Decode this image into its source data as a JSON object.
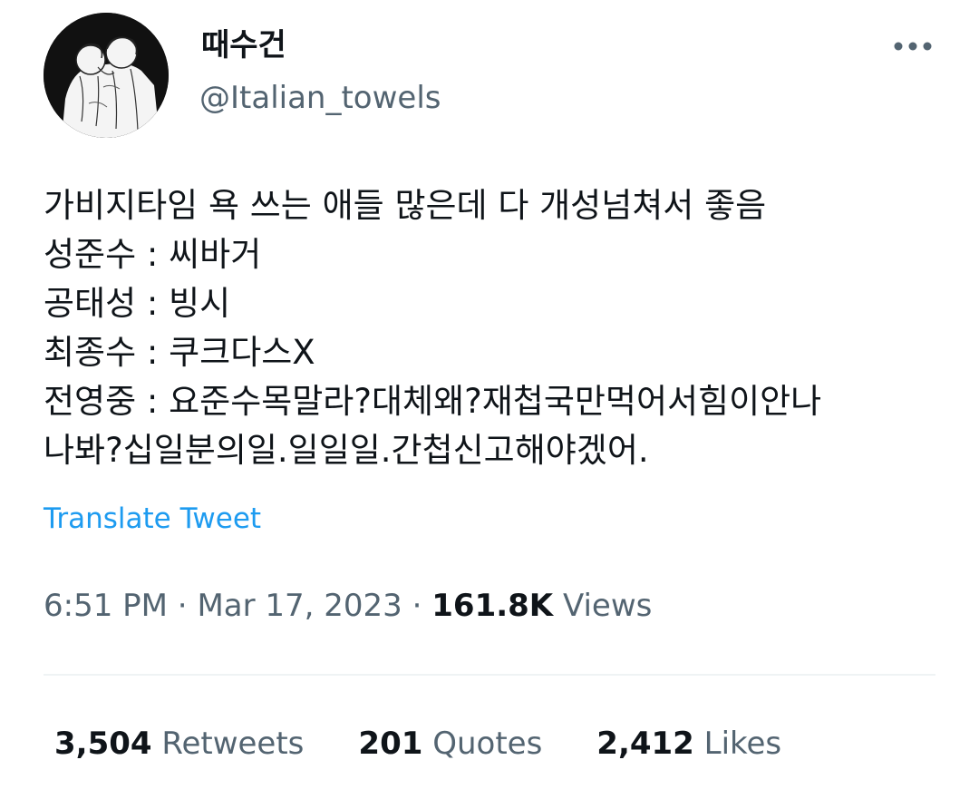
{
  "user": {
    "display_name": "때수건",
    "handle": "@Italian_towels",
    "avatar_icon": "profile-avatar-drawing"
  },
  "tweet": {
    "lines": [
      "가비지타임 욕 쓰는 애들 많은데 다 개성넘쳐서 좋음",
      "성준수 : 씨바거",
      "공태성 : 빙시",
      "최종수 : 쿠크다스X",
      "전영중 : 요준수목말라?대체왜?재첩국만먹어서힘이안나",
      "나봐?십일분의일.일일일.간첩신고해야겠어."
    ],
    "translate_label": "Translate Tweet"
  },
  "meta": {
    "time": "6:51 PM",
    "separator": " · ",
    "date": "Mar 17, 2023",
    "views_count": "161.8K",
    "views_label": "Views"
  },
  "stats": {
    "retweets_count": "3,504",
    "retweets_label": "Retweets",
    "quotes_count": "201",
    "quotes_label": "Quotes",
    "likes_count": "2,412",
    "likes_label": "Likes"
  },
  "icons": {
    "more": "more-options-icon"
  },
  "colors": {
    "text_primary": "#0f1419",
    "text_secondary": "#536471",
    "link": "#1d9bf0",
    "divider": "#eff3f4"
  }
}
